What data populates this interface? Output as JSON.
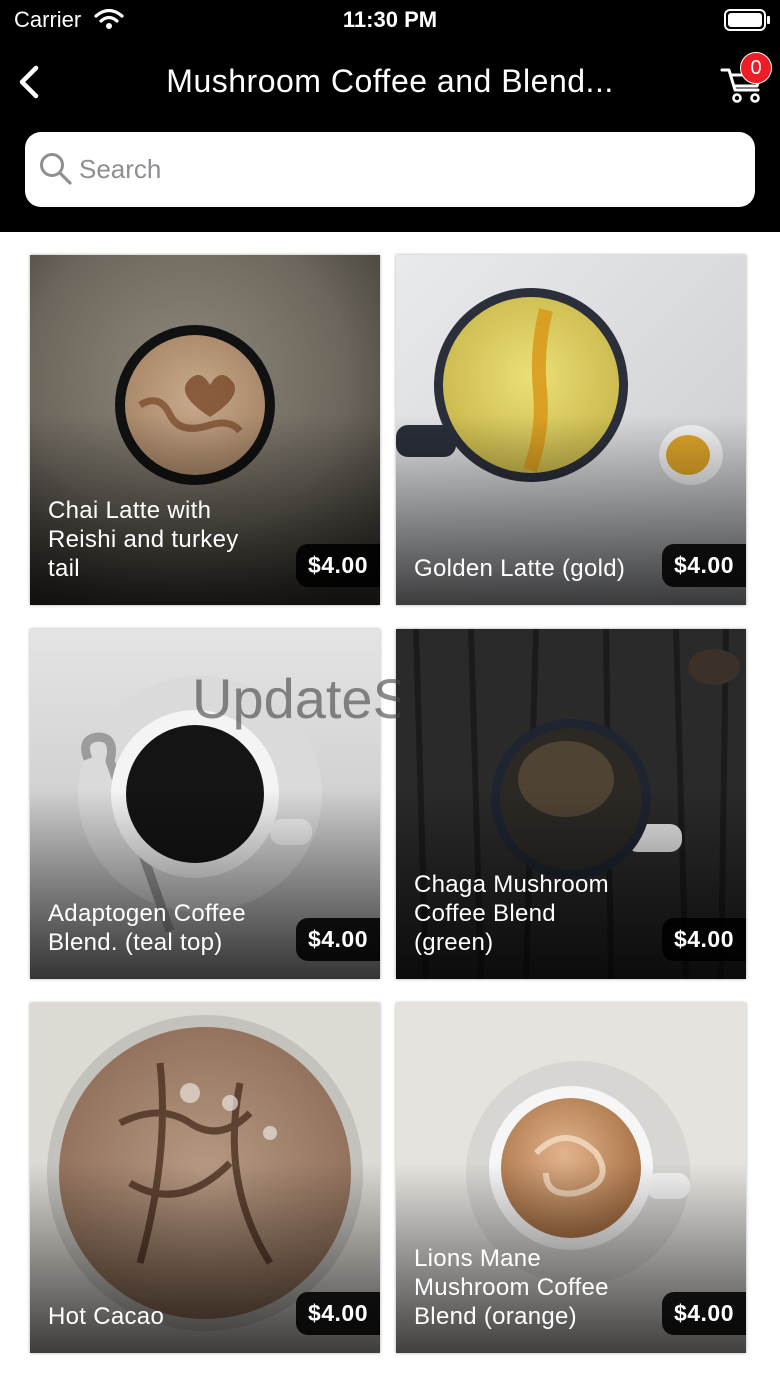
{
  "status_bar": {
    "carrier": "Carrier",
    "time": "11:30 PM"
  },
  "header": {
    "title": "Mushroom Coffee and Blend...",
    "cart_count": "0"
  },
  "search": {
    "placeholder": "Search",
    "value": ""
  },
  "watermark": "UpdateS",
  "products": [
    {
      "name": "Chai Latte with Reishi and turkey tail",
      "price": "$4.00"
    },
    {
      "name": "Golden Latte (gold)",
      "price": "$4.00"
    },
    {
      "name": "Adaptogen Coffee Blend. (teal top)",
      "price": "$4.00"
    },
    {
      "name": "Chaga Mushroom Coffee Blend (green)",
      "price": "$4.00"
    },
    {
      "name": "Hot Cacao",
      "price": "$4.00"
    },
    {
      "name": "Lions Mane Mushroom Coffee Blend (orange)",
      "price": "$4.00"
    }
  ],
  "colors": {
    "header_bg": "#000000",
    "badge": "#ee1c24",
    "page_bg": "#ffffff"
  }
}
